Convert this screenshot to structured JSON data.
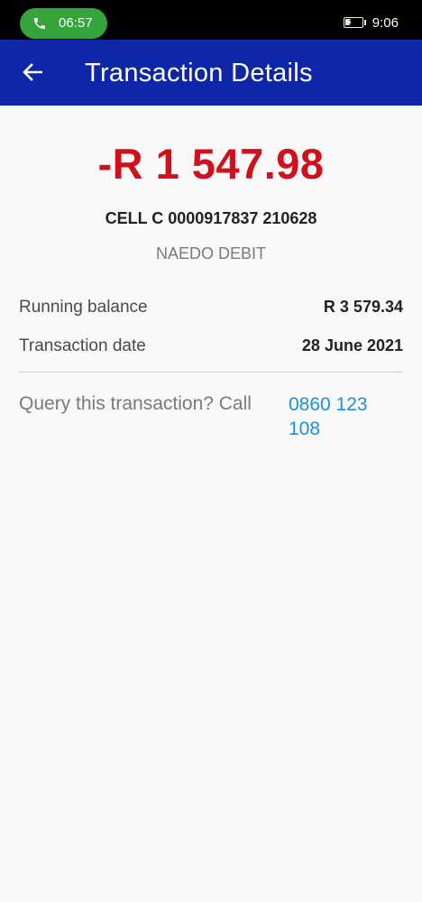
{
  "status_bar": {
    "call_duration": "06:57",
    "battery_level": "36",
    "time": "9:06"
  },
  "app_bar": {
    "title": "Transaction Details",
    "back_icon": "arrow-left-icon"
  },
  "transaction": {
    "amount": "-R 1 547.98",
    "description": "CELL C 0000917837 210628",
    "type": "NAEDO DEBIT"
  },
  "details": [
    {
      "label": "Running balance",
      "value": "R 3 579.34"
    },
    {
      "label": "Transaction date",
      "value": "28 June 2021"
    }
  ],
  "query": {
    "label": "Query this transaction? Call",
    "phone": "0860 123 108"
  },
  "colors": {
    "status_bar": "#000000",
    "call_pill": "#34a43b",
    "app_bar": "#0d27a8",
    "amount_debit": "#d0101c",
    "link": "#1e8fd9",
    "background": "#f8f8f8"
  }
}
